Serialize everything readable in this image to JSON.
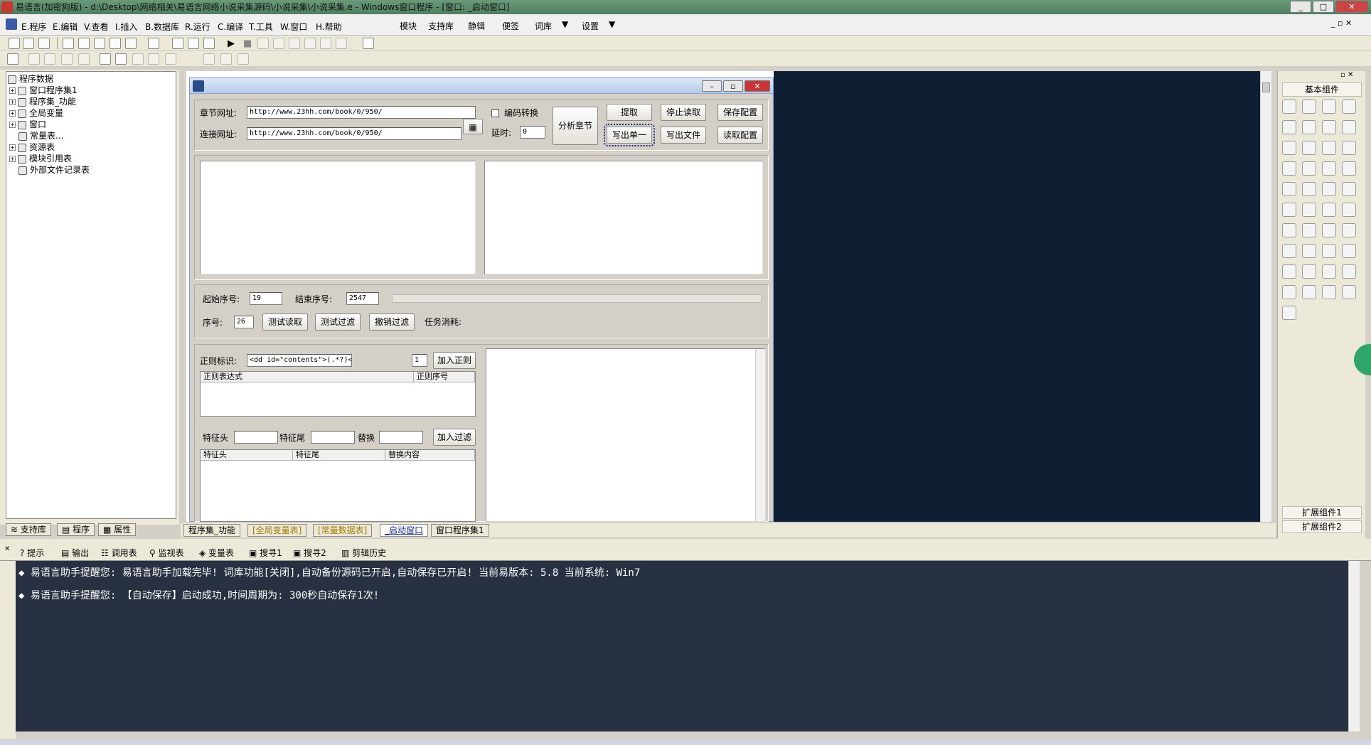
{
  "window": {
    "title": "易语言(加密狗版) - d:\\Desktop\\网络相关\\易语言网络小说采集源码\\小说采集\\小说采集.e - Windows窗口程序 - [窗口: _启动窗口]",
    "btn_min": "_",
    "btn_max": "□",
    "btn_close": "✕"
  },
  "menu": {
    "items": [
      "E.程序",
      "E.编辑",
      "V.查看",
      "I.插入",
      "B.数据库",
      "R.运行",
      "C.编译",
      "T.工具",
      "W.窗口",
      "H.帮助"
    ],
    "extra": [
      "模块",
      "支持库",
      "静辑",
      "便签",
      "词库",
      "设置"
    ]
  },
  "tree": {
    "root": "程序数据",
    "items": [
      "窗口程序集1",
      "程序集_功能",
      "全局变量",
      "窗口",
      "常量表...",
      "资源表",
      "模块引用表",
      "外部文件记录表"
    ]
  },
  "left_tabs": [
    "支持库",
    "程序",
    "属性"
  ],
  "form": {
    "chapter_url_label": "章节网址:",
    "chapter_url_value": "http://www.23hh.com/book/0/950/",
    "link_url_label": "连接网址:",
    "link_url_value": "http://www.23hh.com/book/0/950/",
    "encode_label": "编码转换",
    "delay_label": "延时:",
    "delay_value": "0",
    "analyze_btn": "分析章节",
    "extract_btn": "提取",
    "stop_btn": "停止读取",
    "save_cfg_btn": "保存配置",
    "write_one_btn": "写出单一",
    "write_file_btn": "写出文件",
    "read_cfg_btn": "读取配置",
    "start_label": "起始序号:",
    "start_value": "19",
    "end_label": "结束序号:",
    "end_value": "2547",
    "seq_label": "序号:",
    "seq_value": "26",
    "test_read_btn": "测试读取",
    "test_filter_btn": "测试过滤",
    "undo_filter_btn": "撤销过滤",
    "task_label": "任务消耗:",
    "regex_label": "正则标识:",
    "regex_value": "<dd id=\"contents\">(.*?)</dd>",
    "regex_index_value": "1",
    "add_regex_btn": "加入正则",
    "regex_col1": "正则表达式",
    "regex_col2": "正则序号",
    "feat_head_label": "特征头",
    "feat_tail_label": "特征尾",
    "replace_label": "替换",
    "add_filter_btn": "加入过滤",
    "filter_col1": "特征头",
    "filter_col2": "特征尾",
    "filter_col3": "替换内容"
  },
  "doc_tabs": [
    "程序集_功能",
    "[全局变量表]",
    "[常量数据表]",
    "_启动窗口",
    "窗口程序集1"
  ],
  "palette": {
    "title": "基本组件",
    "ext1": "扩展组件1",
    "ext2": "扩展组件2"
  },
  "output_tabs": [
    "提示",
    "输出",
    "调用表",
    "监视表",
    "变量表",
    "搜寻1",
    "搜寻2",
    "剪辑历史"
  ],
  "output_lines": [
    "易语言助手提醒您:  易语言助手加载完毕!  词库功能[关闭],自动备份源码已开启,自动保存已开启!  当前易版本: 5.8  当前系统: Win7",
    "易语言助手提醒您: 【自动保存】启动成功,时间周期为: 300秒自动保存1次!"
  ],
  "colors": {
    "titlebar": "#5a8a6a",
    "output_bg": "#273141",
    "designer_bg": "#0f1f33"
  }
}
